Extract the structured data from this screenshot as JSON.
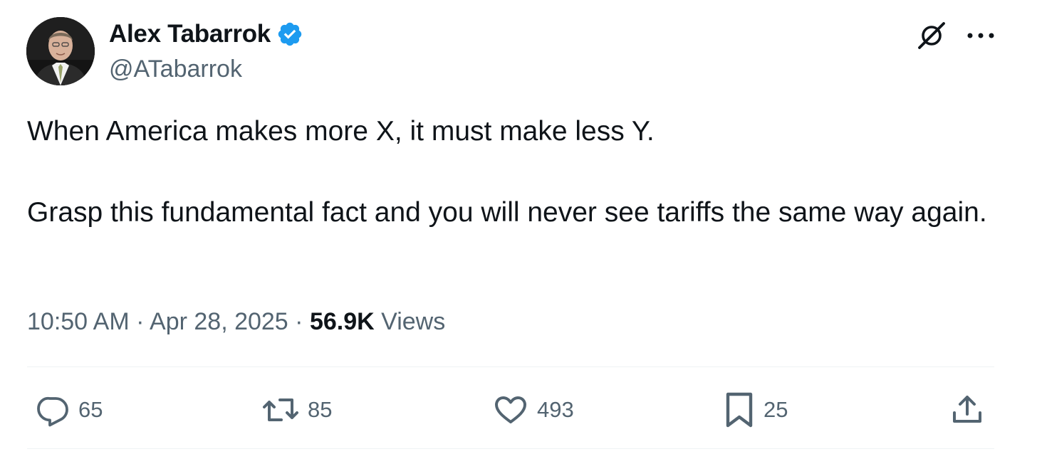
{
  "author": {
    "display_name": "Alex Tabarrok",
    "handle": "@ATabarrok",
    "verified": true
  },
  "tweet": {
    "paragraphs": [
      "When America makes more X, it must make less Y.",
      "Grasp this fundamental fact and you will never see tariffs the same way again."
    ],
    "time": "10:50 AM",
    "separator": "·",
    "date": "Apr 28, 2025",
    "views_count": "56.9K",
    "views_label": "Views"
  },
  "actions": {
    "replies": "65",
    "reposts": "85",
    "likes": "493",
    "bookmarks": "25"
  },
  "icons": {
    "grok": "grok-icon",
    "more": "more-horizontal-icon",
    "reply": "reply-icon",
    "repost": "repost-icon",
    "like": "heart-icon",
    "bookmark": "bookmark-icon",
    "share": "share-icon",
    "verified": "verified-badge-icon"
  },
  "colors": {
    "text_primary": "#0f1419",
    "text_secondary": "#536471",
    "verified_blue": "#1d9bf0",
    "divider": "#eff3f4"
  }
}
